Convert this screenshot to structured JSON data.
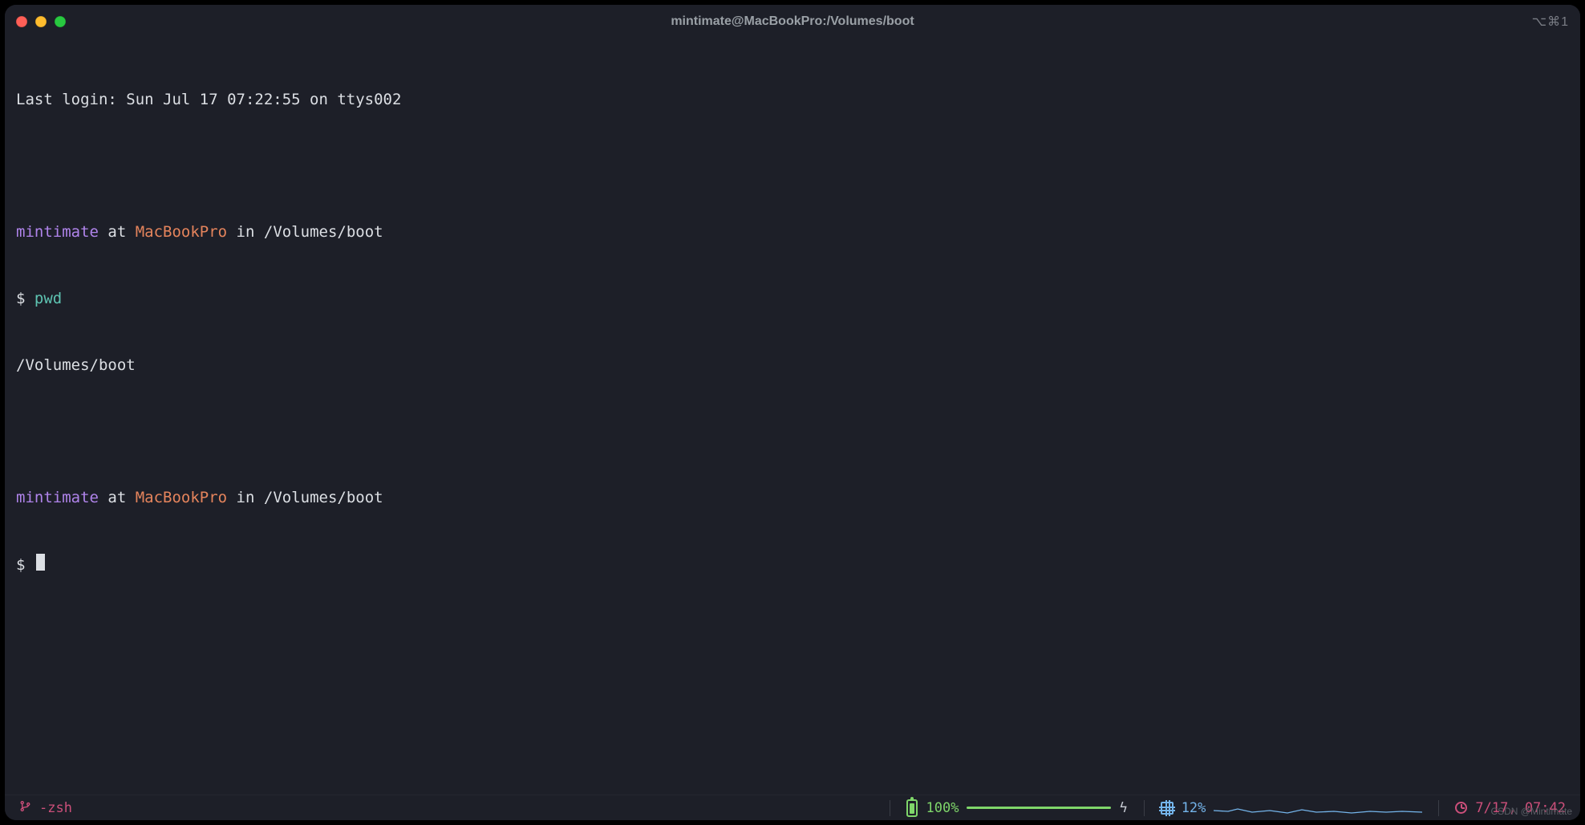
{
  "titlebar": {
    "title": "mintimate@MacBookPro:/Volumes/boot",
    "shortcut_hint": "⌥⌘1"
  },
  "session": {
    "last_login": "Last login: Sun Jul 17 07:22:55 on ttys002",
    "prompt1": {
      "user": "mintimate",
      "at": " at ",
      "host": "MacBookPro",
      "in": " in ",
      "path": "/Volumes/boot",
      "symbol": "$ ",
      "command": "pwd",
      "output": "/Volumes/boot"
    },
    "prompt2": {
      "user": "mintimate",
      "at": " at ",
      "host": "MacBookPro",
      "in": " in ",
      "path": "/Volumes/boot",
      "symbol": "$ "
    }
  },
  "statusbar": {
    "shell": "-zsh",
    "battery_pct": "100%",
    "cpu_pct": "12%",
    "clock": "7/17, 07:42"
  },
  "watermark": "CSDN @Mintimate"
}
